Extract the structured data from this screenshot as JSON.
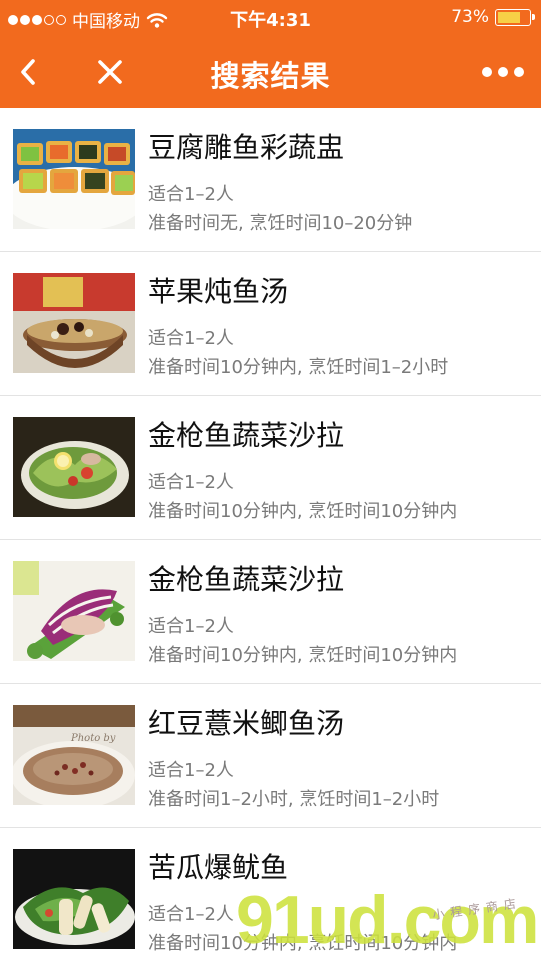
{
  "status_bar": {
    "carrier": "中国移动",
    "time": "下午4:31",
    "battery": "73%",
    "battery_level": 0.73,
    "battery_color": "#f7d046"
  },
  "nav": {
    "title": "搜索结果",
    "back_icon": "chevron-left-icon",
    "close_icon": "close-icon",
    "more_icon": "more-dots-icon"
  },
  "theme": {
    "accent": "#f26a1e"
  },
  "results": [
    {
      "name": "豆腐雕鱼彩蔬盅",
      "people": "适合1–2人",
      "time": "准备时间无, 烹饪时间10–20分钟"
    },
    {
      "name": "苹果炖鱼汤",
      "people": "适合1–2人",
      "time": "准备时间10分钟内, 烹饪时间1–2小时"
    },
    {
      "name": "金枪鱼蔬菜沙拉",
      "people": "适合1–2人",
      "time": "准备时间10分钟内, 烹饪时间10分钟内"
    },
    {
      "name": "金枪鱼蔬菜沙拉",
      "people": "适合1–2人",
      "time": "准备时间10分钟内, 烹饪时间10分钟内"
    },
    {
      "name": "红豆薏米鲫鱼汤",
      "people": "适合1–2人",
      "time": "准备时间1–2小时, 烹饪时间1–2小时"
    },
    {
      "name": "苦瓜爆鱿鱼",
      "people": "适合1–2人",
      "time": "准备时间10分钟内, 烹饪时间10分钟内"
    }
  ],
  "watermark": {
    "text": "91ud.com",
    "subtext": "小程序商店"
  }
}
